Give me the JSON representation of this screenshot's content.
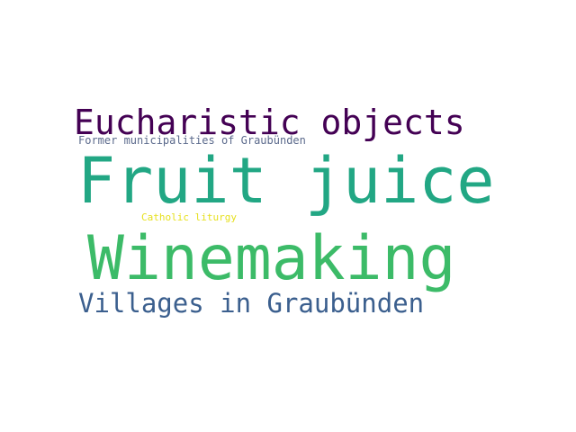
{
  "words": [
    {
      "text": "Eucharistic objects",
      "color": "#440154"
    },
    {
      "text": "Former municipalities of Graubünden",
      "color": "#5b6a8c"
    },
    {
      "text": "Fruit juice",
      "color": "#22a784"
    },
    {
      "text": "Catholic liturgy",
      "color": "#e6e01e"
    },
    {
      "text": "Winemaking",
      "color": "#3cbb68"
    },
    {
      "text": "Villages in Graubünden",
      "color": "#3b5f8e"
    }
  ]
}
